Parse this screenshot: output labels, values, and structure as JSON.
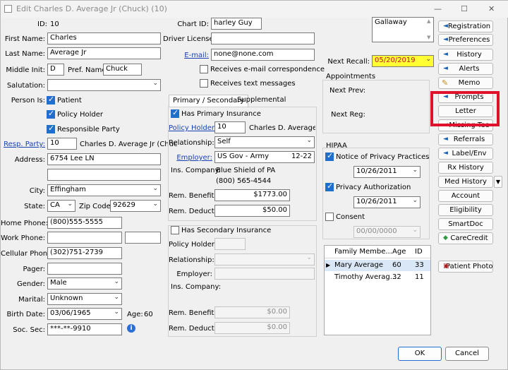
{
  "window": {
    "title": "Edit Charles D. Average Jr (Chuck) (10)",
    "minimize": "—",
    "maximize": "☐",
    "close": "✕"
  },
  "patient": {
    "id_label": "ID:",
    "id": "10",
    "first_name_label": "First Name:",
    "first_name": "Charles",
    "last_name_label": "Last Name:",
    "last_name": "Average Jr",
    "middle_init_label": "Middle Init:",
    "middle_init": "D",
    "pref_name_label": "Pref. Name:",
    "pref_name": "Chuck",
    "salutation_label": "Salutation:",
    "salutation": "",
    "person_is_label": "Person Is:",
    "is_patient": "Patient",
    "is_policy_holder": "Policy Holder",
    "is_responsible": "Responsible Party",
    "resp_party_label": "Resp. Party:",
    "resp_party_id": "10",
    "resp_party_name": "Charles D. Average Jr (Chuc",
    "address_label": "Address:",
    "address1": "6754 Lee LN",
    "address2": "",
    "city_label": "City:",
    "city": "Effingham",
    "state_label": "State:",
    "state": "CA",
    "zip_label": "Zip Code:",
    "zip": "92629",
    "home_phone_label": "Home Phone:",
    "home_phone": "(800)555-5555",
    "work_phone_label": "Work Phone:",
    "work_phone": "",
    "work_ext": "",
    "cell_phone_label": "Cellular Phone:",
    "cell_phone": "(302)751-2739",
    "pager_label": "Pager:",
    "pager": "",
    "gender_label": "Gender:",
    "gender": "Male",
    "marital_label": "Marital:",
    "marital": "Unknown",
    "birth_date_label": "Birth Date:",
    "birth_date": "03/06/1965",
    "age_label": "Age:",
    "age": "60",
    "ssn_label": "Soc. Sec:",
    "ssn": "***-**-9910"
  },
  "middle": {
    "chart_id_label": "Chart ID:",
    "chart_id": "harley Guy",
    "driver_license_label": "Driver License:",
    "driver_license": "",
    "email_label": "E-mail:",
    "email": "none@none.com",
    "receives_email": "Receives e-mail correspondence",
    "receives_text": "Receives text messages",
    "tabs": {
      "primary": "Primary / Secondary",
      "supplemental": "Supplemental"
    }
  },
  "primary_ins": {
    "has_label": "Has Primary Insurance",
    "policy_holder_label": "Policy Holder:",
    "policy_holder_id": "10",
    "policy_holder_name": "Charles D. Average Jr (",
    "relationship_label": "Relationship:",
    "relationship": "Self",
    "employer_label": "Employer:",
    "employer": "US Gov - Army",
    "employer_code": "12-22",
    "ins_company_label": "Ins. Company:",
    "ins_company": "Blue Shield of PA",
    "ins_phone": "(800) 565-4544",
    "rem_benefits_label": "Rem. Benefits:",
    "rem_benefits": "$1773.00",
    "rem_deduct_label": "Rem. Deduct:",
    "rem_deduct": "$50.00"
  },
  "secondary_ins": {
    "has_label": "Has Secondary Insurance",
    "policy_holder_label": "Policy Holder:",
    "relationship_label": "Relationship:",
    "employer_label": "Employer:",
    "ins_company_label": "Ins. Company:",
    "rem_benefits_label": "Rem. Benefits:",
    "rem_benefits": "$0.00",
    "rem_deduct_label": "Rem. Deduct:",
    "rem_deduct": "$0.00"
  },
  "right": {
    "note": "Gallaway",
    "next_recall_label": "Next Recall:",
    "next_recall": "05/20/2019",
    "appointments_label": "Appointments",
    "next_prev_label": "Next Prev:",
    "next_reg_label": "Next Reg:",
    "hipaa_label": "HIPAA",
    "notice_label": "Notice of Privacy Practices",
    "notice_date": "10/26/2011",
    "privacy_auth_label": "Privacy Authorization",
    "privacy_auth_date": "10/26/2011",
    "consent_label": "Consent",
    "consent_date": "00/00/0000"
  },
  "family": {
    "headers": [
      "Family Membe...",
      "Age",
      "ID"
    ],
    "rows": [
      {
        "name": "Mary Average",
        "age": "60",
        "id": "33"
      },
      {
        "name": "Timothy Averag...",
        "age": "32",
        "id": "11"
      }
    ],
    "current_marker": "▶"
  },
  "buttons": {
    "registration": "Registration",
    "preferences": "Preferences",
    "history": "History",
    "alerts": "Alerts",
    "memo": "Memo",
    "prompts": "Prompts",
    "letter": "Letter",
    "missing_teeth": "Missing Tee",
    "referrals": "Referrals",
    "label_env": "Label/Env",
    "rx_history": "Rx History",
    "med_history": "Med History",
    "account": "Account",
    "eligibility": "Eligibility",
    "smartdoc": "SmartDoc",
    "carecredit": "CareCredit",
    "patient_photo": "Patient Photo",
    "ok": "OK",
    "cancel": "Cancel"
  },
  "colors": {
    "recall_bg": "#ffff33",
    "highlight": "#e0112b",
    "check": "#1f6fcf"
  }
}
